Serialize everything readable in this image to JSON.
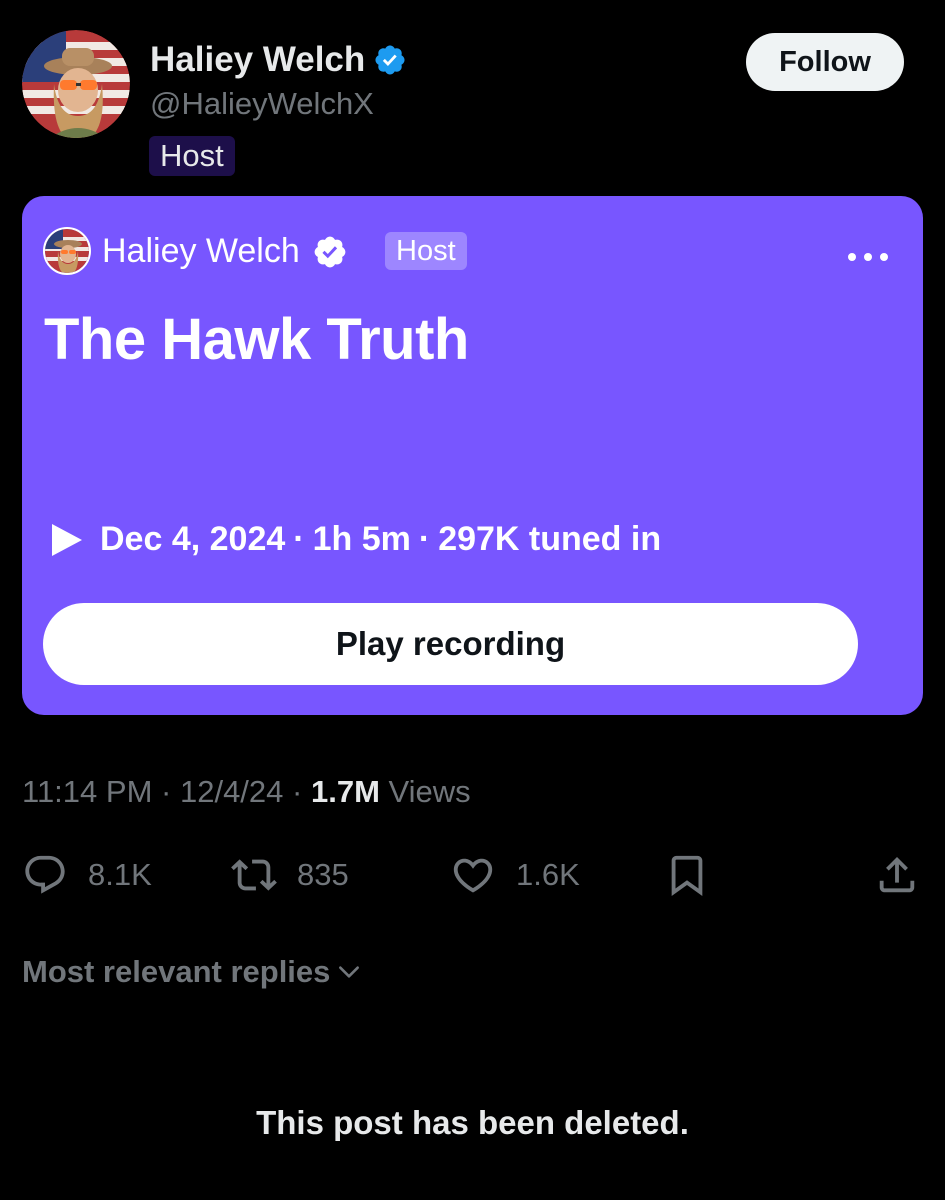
{
  "author": {
    "name": "Haliey Welch",
    "handle": "@HalieyWelchX",
    "role_tag": "Host",
    "follow_label": "Follow"
  },
  "space": {
    "host_name": "Haliey Welch",
    "host_tag": "Host",
    "title": "The Hawk Truth",
    "date": "Dec 4, 2024",
    "duration": "1h 5m",
    "tuned_in": "297K tuned in",
    "play_label": "Play recording",
    "bg_color": "#7856ff"
  },
  "post_meta": {
    "time": "11:14 PM",
    "date": "12/4/24",
    "views_count": "1.7M",
    "views_label": "Views",
    "separator": "·"
  },
  "actions": {
    "replies": "8.1K",
    "reposts": "835",
    "likes": "1.6K"
  },
  "replies_sort_label": "Most relevant replies",
  "deleted_message": "This post has been deleted.",
  "colors": {
    "background": "#000000",
    "verified_blue": "#1d9bf0",
    "muted_text": "#71767b",
    "primary_text": "#e7e9ea"
  },
  "icons": [
    "verified-badge-icon",
    "more-icon",
    "play-icon",
    "reply-icon",
    "repost-icon",
    "like-icon",
    "bookmark-icon",
    "share-icon",
    "chevron-down-icon"
  ]
}
